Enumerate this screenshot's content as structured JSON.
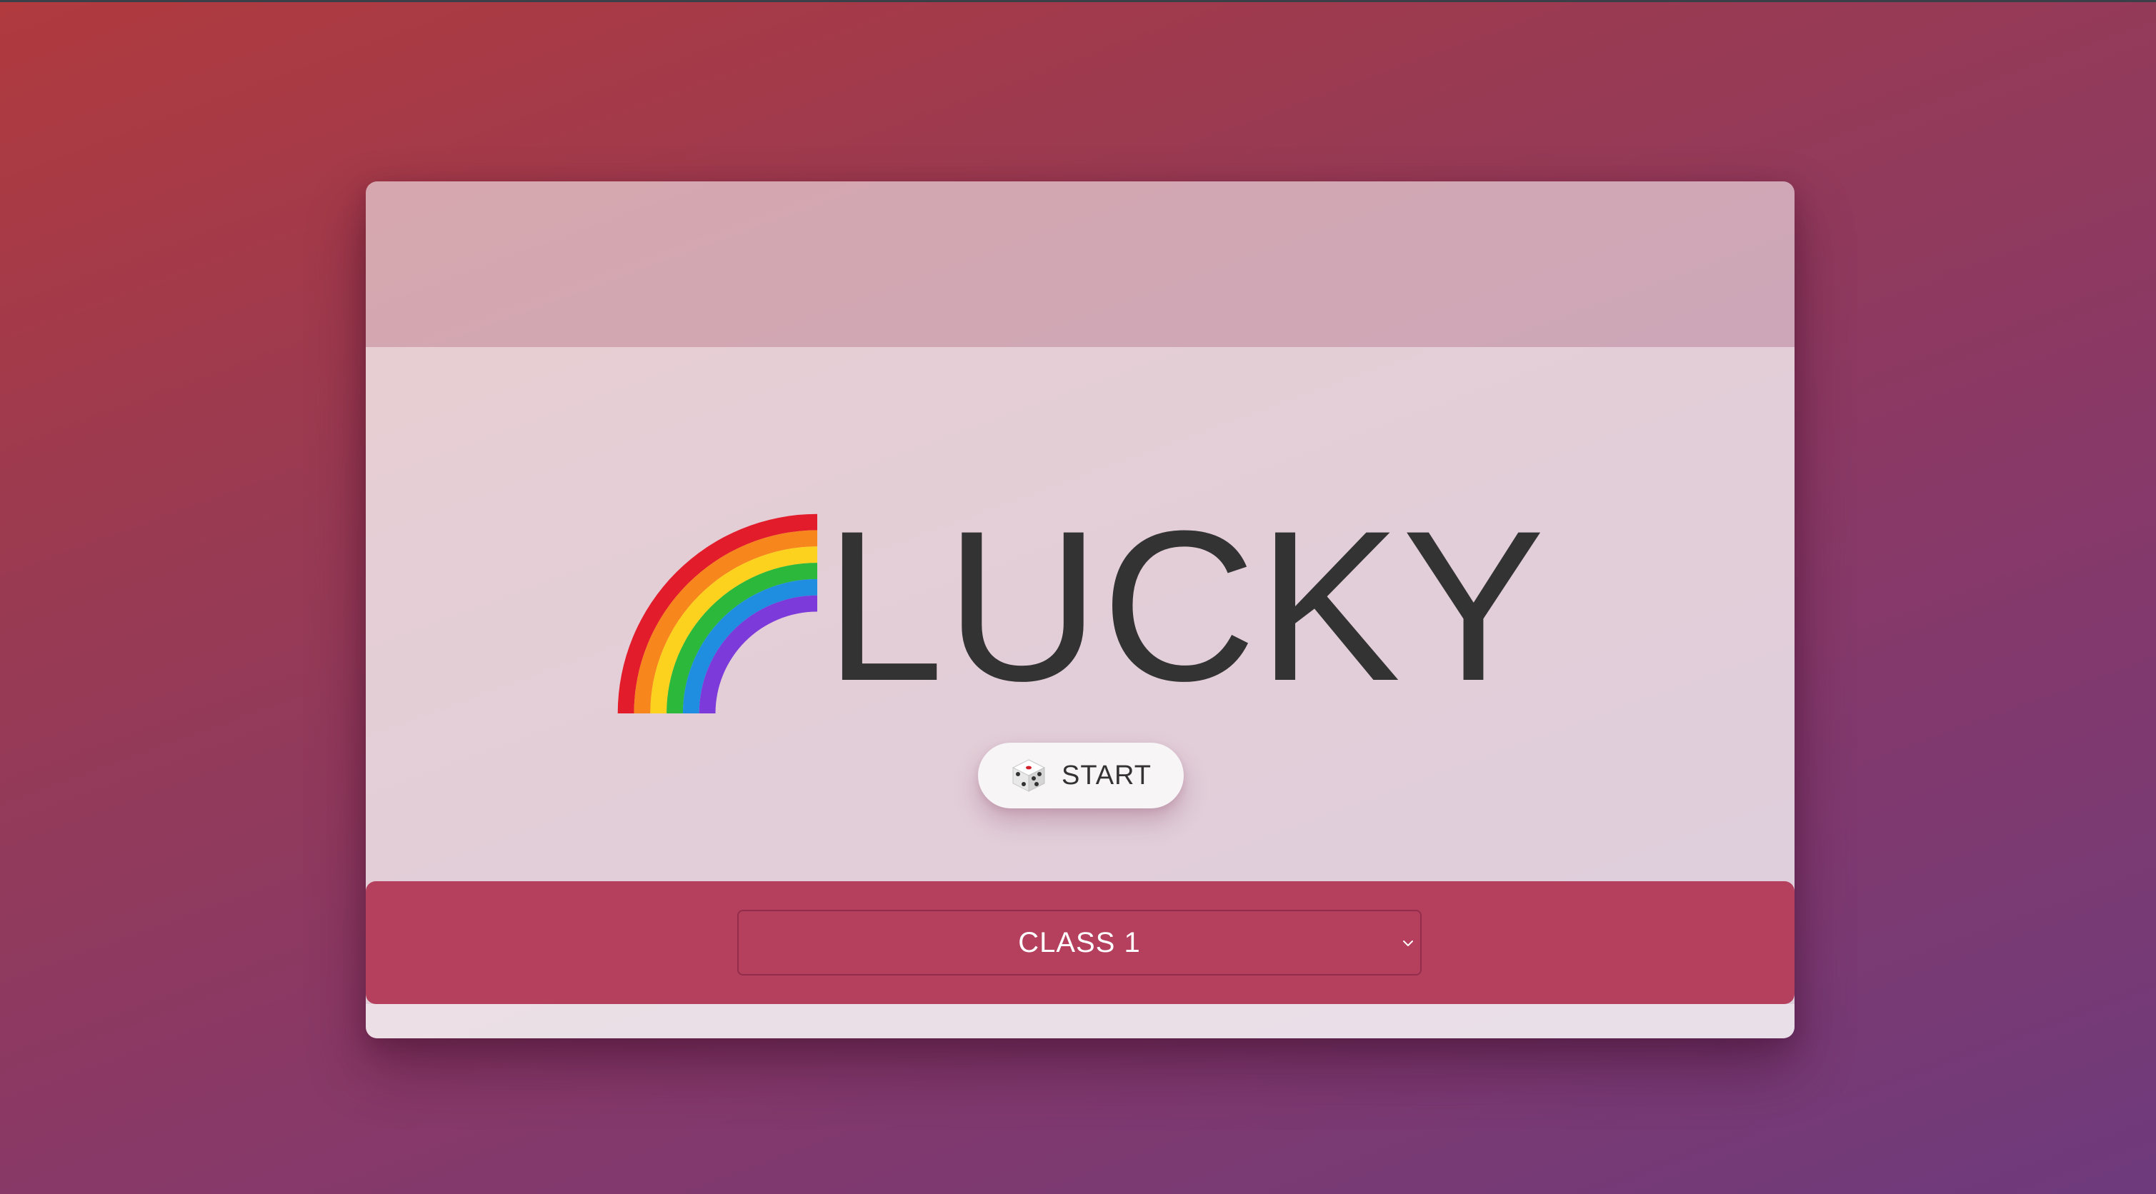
{
  "app": {
    "title": "LUCKY"
  },
  "controls": {
    "start_label": "START",
    "class_select": {
      "selected": "CLASS 1"
    }
  },
  "icons": {
    "title_icon": "rainbow-icon",
    "start_icon": "dice-icon",
    "select_icon": "chevron-down-icon"
  },
  "colors": {
    "footer_bar": "#b4405e",
    "title_text": "#333333",
    "button_bg": "#f7f5f6"
  }
}
